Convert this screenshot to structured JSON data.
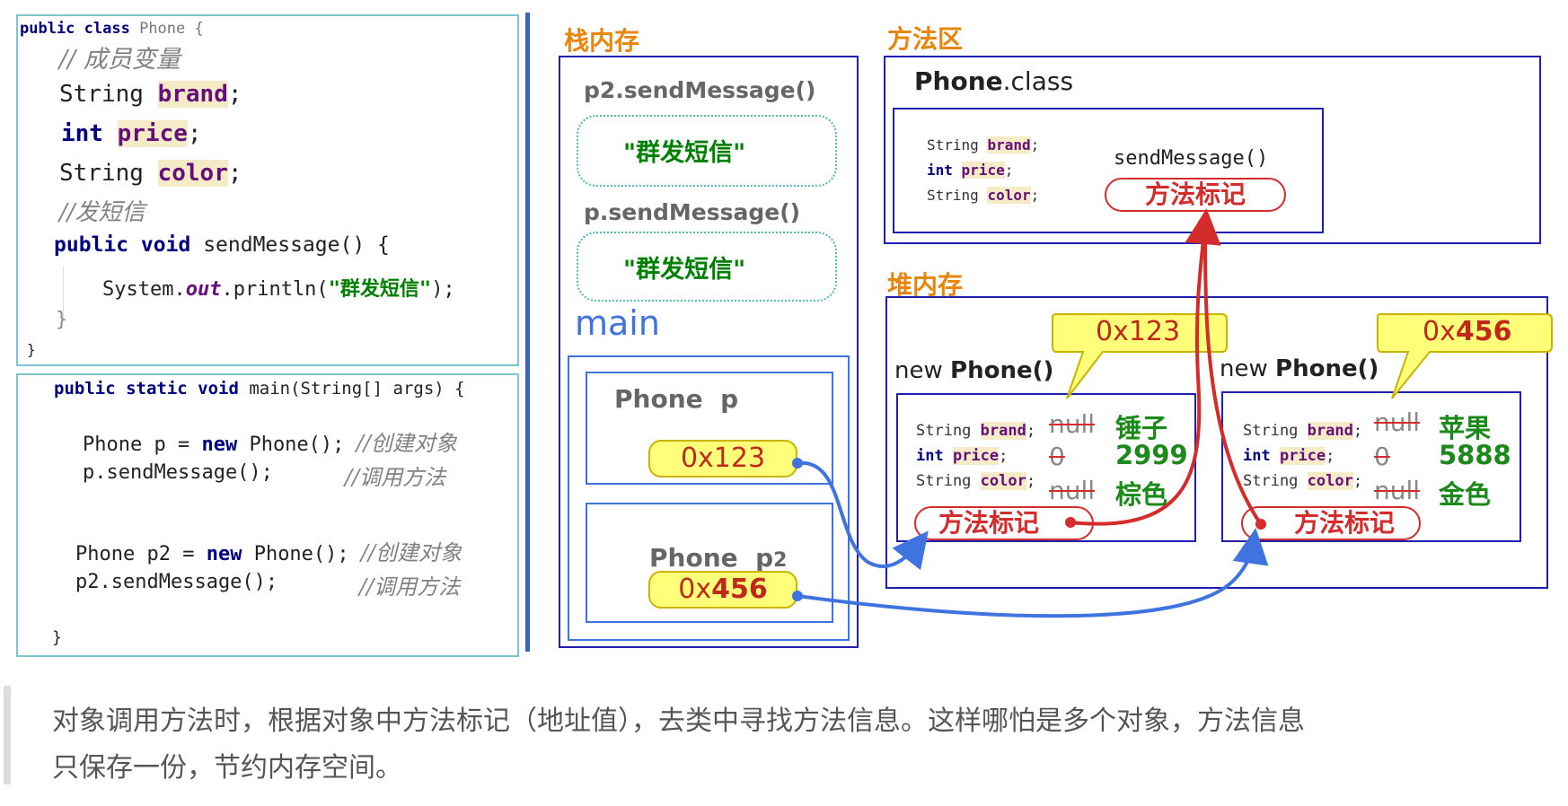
{
  "class_code": {
    "line1": [
      "public class",
      "Phone {"
    ],
    "comment_members": "// 成员变量",
    "field_brand": [
      "String",
      "brand",
      ";"
    ],
    "field_price": [
      "int",
      "price",
      ";"
    ],
    "field_color": [
      "String",
      "color",
      ";"
    ],
    "comment_send": "//发短信",
    "method_sig": [
      "public void",
      "sendMessage() {"
    ],
    "println": [
      "System.",
      "out",
      ".println(",
      "\"群发短信\"",
      ");"
    ],
    "close_method": "}",
    "close_class": "}"
  },
  "main_code": {
    "sig": [
      "public static void",
      "main(String[] args) {"
    ],
    "line_p": [
      "Phone p = ",
      "new",
      " Phone();",
      "//创建对象"
    ],
    "line_p_call": [
      "p.sendMessage();",
      "//调用方法"
    ],
    "line_p2": [
      "Phone p2 = ",
      "new",
      " Phone();",
      "//创建对象"
    ],
    "line_p2_call": [
      "p2.sendMessage();",
      "//调用方法"
    ],
    "close": "}"
  },
  "stack": {
    "title": "栈内存",
    "frame2_label": "p2.sendMessage()",
    "frame2_output": "\"群发短信\"",
    "frame1_label": "p.sendMessage()",
    "frame1_output": "\"群发短信\"",
    "main_label": "main",
    "var_p": "Phone  p",
    "var_p_addr": "0x123",
    "var_p2_prefix": "Phone  p",
    "var_p2_sub": "2",
    "var_p2_addr_prefix": "0x",
    "var_p2_addr_bold": "456"
  },
  "method_area": {
    "title": "方法区",
    "class_name_bold": "Phone",
    "class_name_rest": ".class",
    "field_brand": [
      "String",
      "brand",
      ";"
    ],
    "field_price": [
      "int",
      "price",
      ";"
    ],
    "field_color": [
      "String",
      "color",
      ";"
    ],
    "method_name": "sendMessage()",
    "method_mark": "方法标记"
  },
  "heap": {
    "title": "堆内存",
    "obj1": {
      "header_new": "new",
      "header_class": "Phone()",
      "callout": "0x123",
      "field_brand": [
        "String",
        "brand",
        ";"
      ],
      "field_price": [
        "int",
        "price",
        ";"
      ],
      "field_color": [
        "String",
        "color",
        ";"
      ],
      "old_brand": "null",
      "new_brand": "锤子",
      "old_price": "0",
      "new_price": "2999",
      "old_color": "null",
      "new_color": "棕色",
      "mark": "方法标记"
    },
    "obj2": {
      "header_new": "new",
      "header_class": "Phone()",
      "callout_prefix": "0x",
      "callout_bold": "456",
      "field_brand": [
        "String",
        "brand",
        ";"
      ],
      "field_price": [
        "int",
        "price",
        ";"
      ],
      "field_color": [
        "String",
        "color",
        ";"
      ],
      "old_brand": "null",
      "new_brand": "苹果",
      "old_price": "0",
      "new_price": "5888",
      "old_color": "null",
      "new_color": "金色",
      "mark": "方法标记"
    }
  },
  "note": {
    "line1": "对象调用方法时，根据对象中方法标记（地址值），去类中寻找方法信息。这样哪怕是多个对象，方法信息",
    "line2": "只保存一份，节约内存空间。"
  },
  "colors": {
    "frame_teal": "#7cc6cf",
    "frame_blue": "#1f1fb0",
    "divider": "#3a62c9",
    "arrow_blue": "#3f73e0",
    "arrow_red": "#d62b2b",
    "title_orange": "#e8860c",
    "callout_yellow": "#ffff7a"
  }
}
